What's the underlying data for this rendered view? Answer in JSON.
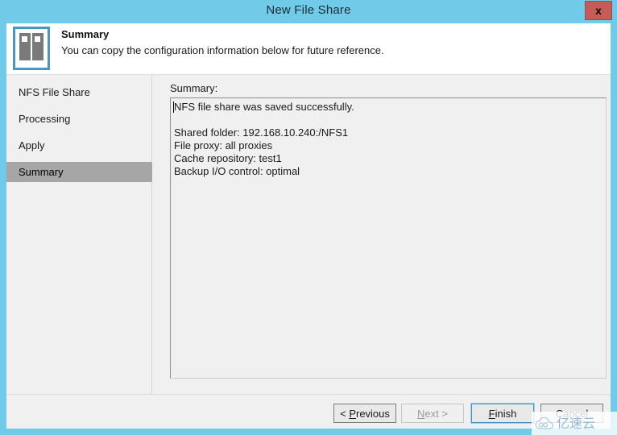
{
  "window": {
    "title": "New File Share",
    "close_label": "x",
    "accent_color": "#6fcbe8",
    "close_color": "#c75b57"
  },
  "header": {
    "icon": "file-share-server-icon",
    "title": "Summary",
    "subtitle": "You can copy the configuration information below for future reference."
  },
  "sidebar": {
    "items": [
      {
        "label": "NFS File Share",
        "selected": false
      },
      {
        "label": "Processing",
        "selected": false
      },
      {
        "label": "Apply",
        "selected": false
      },
      {
        "label": "Summary",
        "selected": true
      }
    ],
    "selected_color": "#a6a6a6"
  },
  "main": {
    "summary_label": "Summary:",
    "summary_text": "NFS file share was saved successfully.\n\nShared folder: 192.168.10.240:/NFS1\nFile proxy: all proxies\nCache repository: test1\nBackup I/O control: optimal"
  },
  "footer": {
    "previous": {
      "label": "< Previous",
      "accesskey": "P",
      "enabled": true
    },
    "next": {
      "label": "Next >",
      "accesskey": "N",
      "enabled": false
    },
    "finish": {
      "label": "Finish",
      "accesskey": "F",
      "enabled": true,
      "default": true
    },
    "cancel": {
      "label": "Cancel",
      "enabled": true
    }
  },
  "watermark": {
    "text": "亿速云",
    "color": "#8fb8d6"
  }
}
